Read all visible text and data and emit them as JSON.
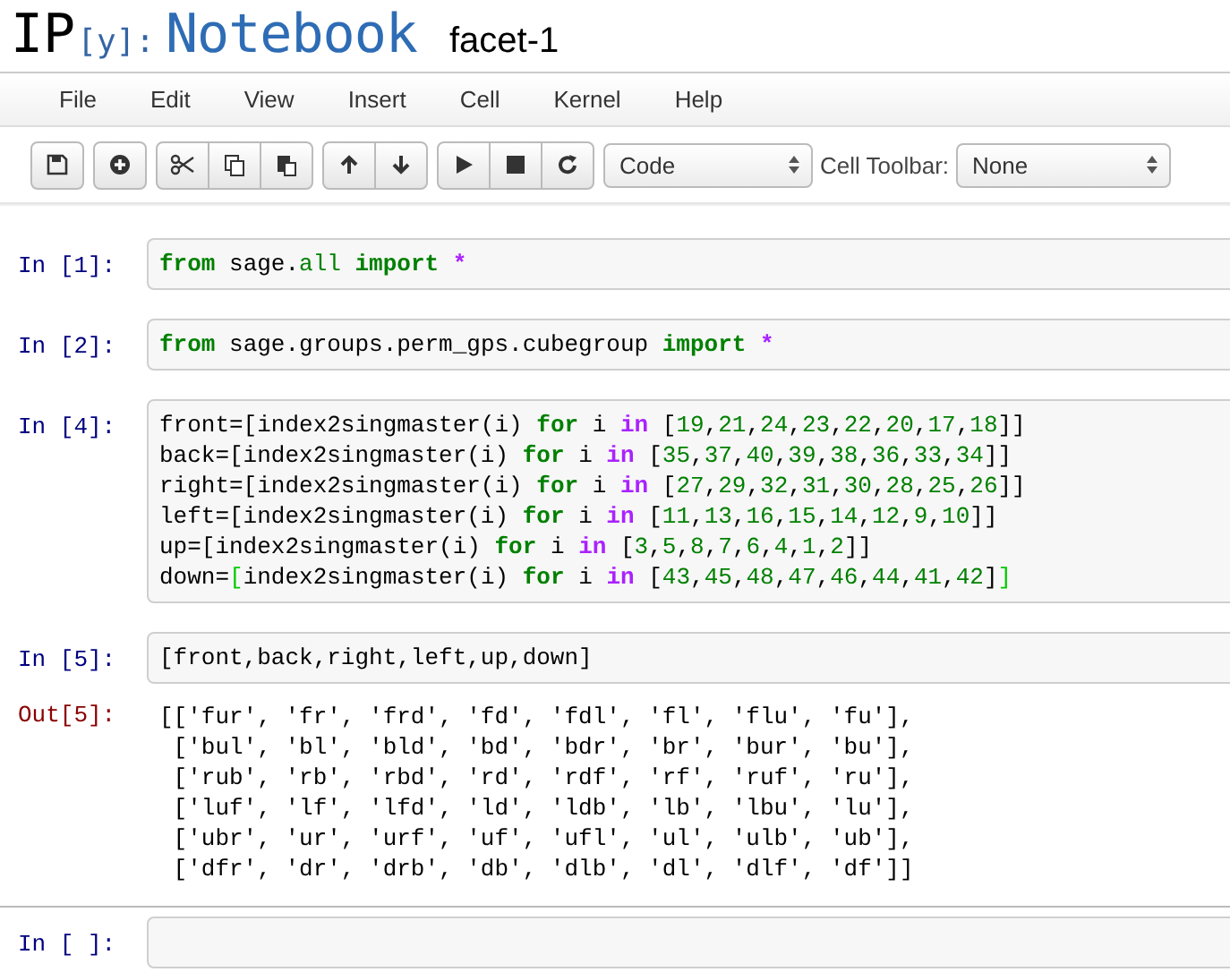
{
  "header": {
    "logo_ip": "IP",
    "logo_y": "[y]:",
    "logo_name": "Notebook",
    "notebook_name": "facet-1"
  },
  "menu": [
    "File",
    "Edit",
    "View",
    "Insert",
    "Cell",
    "Kernel",
    "Help"
  ],
  "toolbar": {
    "cell_type": "Code",
    "cell_toolbar_label": "Cell Toolbar:",
    "cell_toolbar": "None"
  },
  "cells": [
    {
      "prompt": "In [1]:",
      "selected": false,
      "lines": [
        [
          {
            "kind": "kw",
            "text": "from"
          },
          {
            "kind": "txt",
            "text": " sage."
          },
          {
            "kind": "builtin",
            "text": "all"
          },
          {
            "kind": "kw",
            "text": " import"
          },
          {
            "kind": "op",
            "text": " *"
          }
        ]
      ]
    },
    {
      "prompt": "In [2]:",
      "selected": false,
      "lines": [
        [
          {
            "kind": "kw",
            "text": "from"
          },
          {
            "kind": "txt",
            "text": " sage.groups.perm_gps.cubegroup"
          },
          {
            "kind": "kw",
            "text": " import"
          },
          {
            "kind": "op",
            "text": " *"
          }
        ]
      ]
    },
    {
      "prompt": "In [4]:",
      "selected": false,
      "lines": [
        [
          {
            "kind": "txt",
            "text": "front=[index2singmaster(i)"
          },
          {
            "kind": "kw",
            "text": " for"
          },
          {
            "kind": "txt",
            "text": " i"
          },
          {
            "kind": "op",
            "text": " in"
          },
          {
            "kind": "txt",
            "text": " ["
          },
          {
            "kind": "num",
            "text": "19"
          },
          {
            "kind": "txt",
            "text": ","
          },
          {
            "kind": "num",
            "text": "21"
          },
          {
            "kind": "txt",
            "text": ","
          },
          {
            "kind": "num",
            "text": "24"
          },
          {
            "kind": "txt",
            "text": ","
          },
          {
            "kind": "num",
            "text": "23"
          },
          {
            "kind": "txt",
            "text": ","
          },
          {
            "kind": "num",
            "text": "22"
          },
          {
            "kind": "txt",
            "text": ","
          },
          {
            "kind": "num",
            "text": "20"
          },
          {
            "kind": "txt",
            "text": ","
          },
          {
            "kind": "num",
            "text": "17"
          },
          {
            "kind": "txt",
            "text": ","
          },
          {
            "kind": "num",
            "text": "18"
          },
          {
            "kind": "txt",
            "text": "]]"
          }
        ],
        [
          {
            "kind": "txt",
            "text": "back=[index2singmaster(i)"
          },
          {
            "kind": "kw",
            "text": " for"
          },
          {
            "kind": "txt",
            "text": " i"
          },
          {
            "kind": "op",
            "text": " in"
          },
          {
            "kind": "txt",
            "text": " ["
          },
          {
            "kind": "num",
            "text": "35"
          },
          {
            "kind": "txt",
            "text": ","
          },
          {
            "kind": "num",
            "text": "37"
          },
          {
            "kind": "txt",
            "text": ","
          },
          {
            "kind": "num",
            "text": "40"
          },
          {
            "kind": "txt",
            "text": ","
          },
          {
            "kind": "num",
            "text": "39"
          },
          {
            "kind": "txt",
            "text": ","
          },
          {
            "kind": "num",
            "text": "38"
          },
          {
            "kind": "txt",
            "text": ","
          },
          {
            "kind": "num",
            "text": "36"
          },
          {
            "kind": "txt",
            "text": ","
          },
          {
            "kind": "num",
            "text": "33"
          },
          {
            "kind": "txt",
            "text": ","
          },
          {
            "kind": "num",
            "text": "34"
          },
          {
            "kind": "txt",
            "text": "]]"
          }
        ],
        [
          {
            "kind": "txt",
            "text": "right=[index2singmaster(i)"
          },
          {
            "kind": "kw",
            "text": " for"
          },
          {
            "kind": "txt",
            "text": " i"
          },
          {
            "kind": "op",
            "text": " in"
          },
          {
            "kind": "txt",
            "text": " ["
          },
          {
            "kind": "num",
            "text": "27"
          },
          {
            "kind": "txt",
            "text": ","
          },
          {
            "kind": "num",
            "text": "29"
          },
          {
            "kind": "txt",
            "text": ","
          },
          {
            "kind": "num",
            "text": "32"
          },
          {
            "kind": "txt",
            "text": ","
          },
          {
            "kind": "num",
            "text": "31"
          },
          {
            "kind": "txt",
            "text": ","
          },
          {
            "kind": "num",
            "text": "30"
          },
          {
            "kind": "txt",
            "text": ","
          },
          {
            "kind": "num",
            "text": "28"
          },
          {
            "kind": "txt",
            "text": ","
          },
          {
            "kind": "num",
            "text": "25"
          },
          {
            "kind": "txt",
            "text": ","
          },
          {
            "kind": "num",
            "text": "26"
          },
          {
            "kind": "txt",
            "text": "]]"
          }
        ],
        [
          {
            "kind": "txt",
            "text": "left=[index2singmaster(i)"
          },
          {
            "kind": "kw",
            "text": " for"
          },
          {
            "kind": "txt",
            "text": " i"
          },
          {
            "kind": "op",
            "text": " in"
          },
          {
            "kind": "txt",
            "text": " ["
          },
          {
            "kind": "num",
            "text": "11"
          },
          {
            "kind": "txt",
            "text": ","
          },
          {
            "kind": "num",
            "text": "13"
          },
          {
            "kind": "txt",
            "text": ","
          },
          {
            "kind": "num",
            "text": "16"
          },
          {
            "kind": "txt",
            "text": ","
          },
          {
            "kind": "num",
            "text": "15"
          },
          {
            "kind": "txt",
            "text": ","
          },
          {
            "kind": "num",
            "text": "14"
          },
          {
            "kind": "txt",
            "text": ","
          },
          {
            "kind": "num",
            "text": "12"
          },
          {
            "kind": "txt",
            "text": ","
          },
          {
            "kind": "num",
            "text": "9"
          },
          {
            "kind": "txt",
            "text": ","
          },
          {
            "kind": "num",
            "text": "10"
          },
          {
            "kind": "txt",
            "text": "]]"
          }
        ],
        [
          {
            "kind": "txt",
            "text": "up=[index2singmaster(i)"
          },
          {
            "kind": "kw",
            "text": " for"
          },
          {
            "kind": "txt",
            "text": " i"
          },
          {
            "kind": "op",
            "text": " in"
          },
          {
            "kind": "txt",
            "text": " ["
          },
          {
            "kind": "num",
            "text": "3"
          },
          {
            "kind": "txt",
            "text": ","
          },
          {
            "kind": "num",
            "text": "5"
          },
          {
            "kind": "txt",
            "text": ","
          },
          {
            "kind": "num",
            "text": "8"
          },
          {
            "kind": "txt",
            "text": ","
          },
          {
            "kind": "num",
            "text": "7"
          },
          {
            "kind": "txt",
            "text": ","
          },
          {
            "kind": "num",
            "text": "6"
          },
          {
            "kind": "txt",
            "text": ","
          },
          {
            "kind": "num",
            "text": "4"
          },
          {
            "kind": "txt",
            "text": ","
          },
          {
            "kind": "num",
            "text": "1"
          },
          {
            "kind": "txt",
            "text": ","
          },
          {
            "kind": "num",
            "text": "2"
          },
          {
            "kind": "txt",
            "text": "]]"
          }
        ],
        [
          {
            "kind": "txt",
            "text": "down="
          },
          {
            "kind": "match",
            "text": "["
          },
          {
            "kind": "txt",
            "text": "index2singmaster(i)"
          },
          {
            "kind": "kw",
            "text": " for"
          },
          {
            "kind": "txt",
            "text": " i"
          },
          {
            "kind": "op",
            "text": " in"
          },
          {
            "kind": "txt",
            "text": " ["
          },
          {
            "kind": "num",
            "text": "43"
          },
          {
            "kind": "txt",
            "text": ","
          },
          {
            "kind": "num",
            "text": "45"
          },
          {
            "kind": "txt",
            "text": ","
          },
          {
            "kind": "num",
            "text": "48"
          },
          {
            "kind": "txt",
            "text": ","
          },
          {
            "kind": "num",
            "text": "47"
          },
          {
            "kind": "txt",
            "text": ","
          },
          {
            "kind": "num",
            "text": "46"
          },
          {
            "kind": "txt",
            "text": ","
          },
          {
            "kind": "num",
            "text": "44"
          },
          {
            "kind": "txt",
            "text": ","
          },
          {
            "kind": "num",
            "text": "41"
          },
          {
            "kind": "txt",
            "text": ","
          },
          {
            "kind": "num",
            "text": "42"
          },
          {
            "kind": "txt",
            "text": "]"
          },
          {
            "kind": "match",
            "text": "]"
          }
        ]
      ]
    },
    {
      "prompt": "In [5]:",
      "selected": false,
      "lines": [
        [
          {
            "kind": "txt",
            "text": "[front,back,right,left,up,down]"
          }
        ]
      ],
      "output": {
        "prompt": "Out[5]:",
        "lines": [
          "[['fur', 'fr', 'frd', 'fd', 'fdl', 'fl', 'flu', 'fu'],",
          " ['bul', 'bl', 'bld', 'bd', 'bdr', 'br', 'bur', 'bu'],",
          " ['rub', 'rb', 'rbd', 'rd', 'rdf', 'rf', 'ruf', 'ru'],",
          " ['luf', 'lf', 'lfd', 'ld', 'ldb', 'lb', 'lbu', 'lu'],",
          " ['ubr', 'ur', 'urf', 'uf', 'ufl', 'ul', 'ulb', 'ub'],",
          " ['dfr', 'dr', 'drb', 'db', 'dlb', 'dl', 'dlf', 'df']]"
        ]
      }
    },
    {
      "prompt": "In [ ]:",
      "selected": true
    }
  ]
}
